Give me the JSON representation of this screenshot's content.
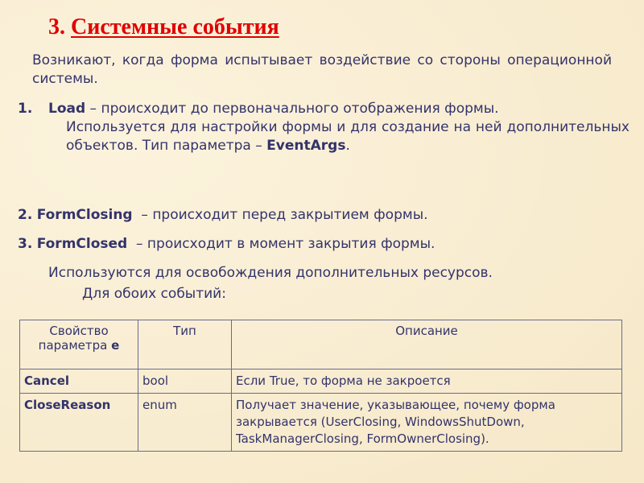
{
  "title": {
    "number": "3.",
    "text": "Системные события"
  },
  "intro": "Возникают, когда форма испытывает воздействие со стороны операционной системы.",
  "items": [
    {
      "num": "1.",
      "name": "Load",
      "text1": " – происходит до первоначального отображения формы.",
      "text2": "Используется для настройки формы и для создание на ней дополнительных объектов. Тип параметра – ",
      "param": "EventArgs",
      "end": "."
    },
    {
      "num": "2.",
      "name": "FormClosing",
      "text": "  – происходит перед закрытием формы."
    },
    {
      "num": "3.",
      "name": "FormClosed",
      "text": "  – происходит в момент закрытия формы."
    }
  ],
  "note": "Используются для освобождения дополнительных ресурсов.",
  "note2": "Для обоих событий:",
  "table": {
    "headers": {
      "prop": "Свойство параметра ",
      "prop_bold": "e",
      "type": "Тип",
      "desc": "Описание"
    },
    "rows": [
      {
        "prop": "Cancel",
        "type": "bool",
        "desc": "Если True, то форма не закроется"
      },
      {
        "prop": "CloseReason",
        "type": "enum",
        "desc": "Получает значение, указывающее, почему форма закрывается (UserClosing, WindowsShutDown, TaskManagerClosing, FormOwnerClosing)."
      }
    ]
  }
}
